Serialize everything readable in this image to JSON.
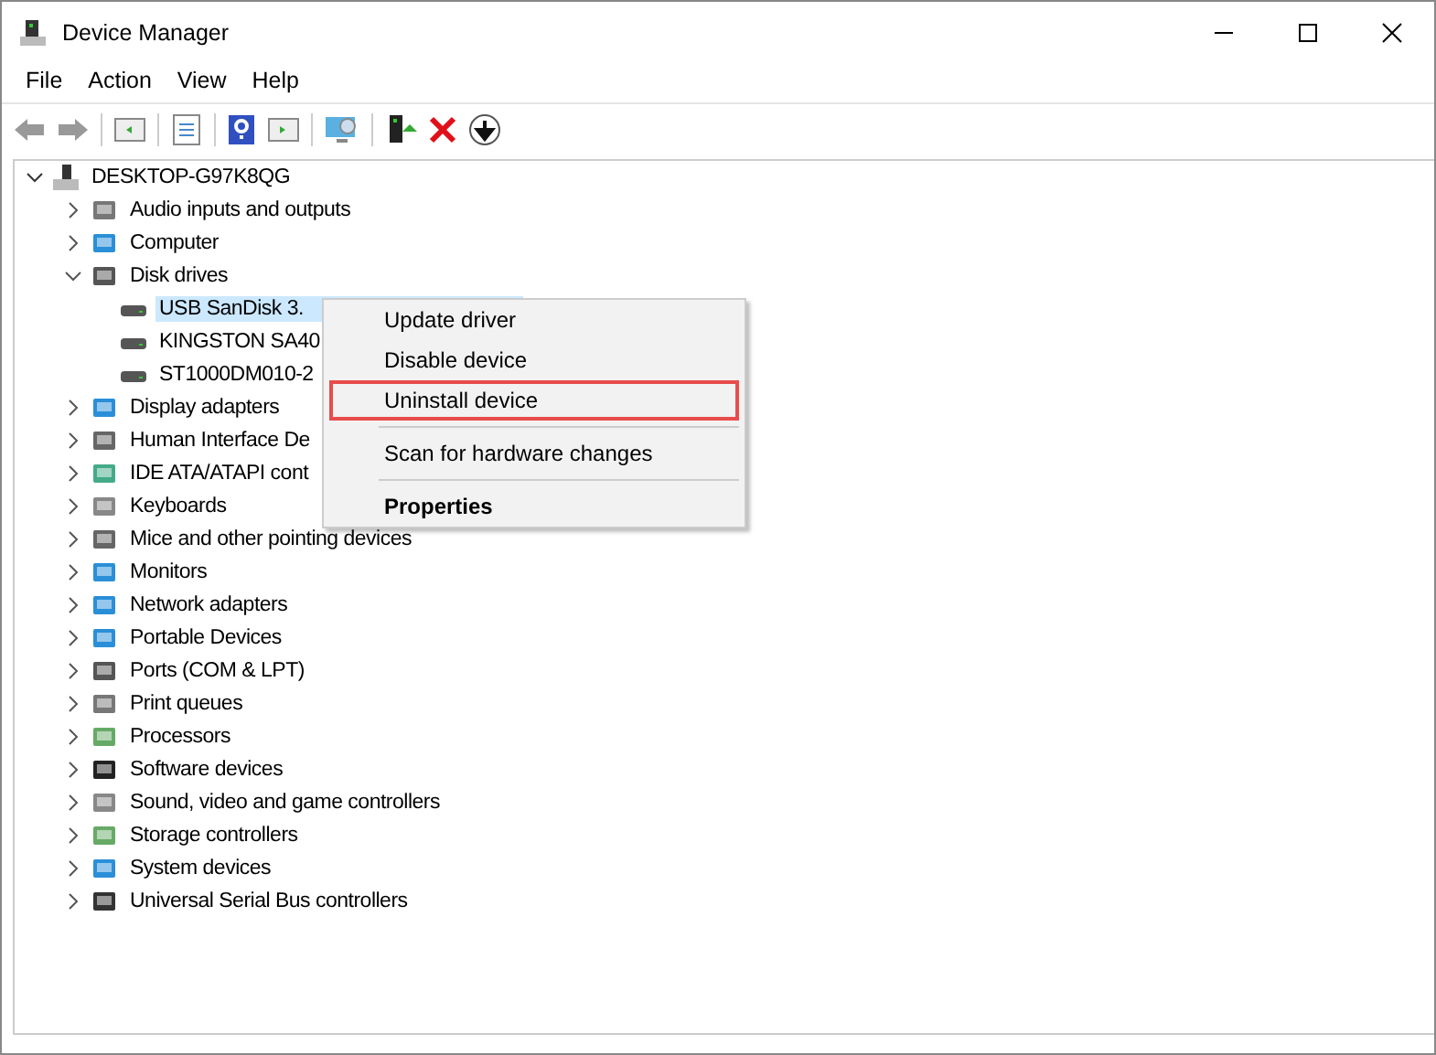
{
  "window": {
    "title": "Device Manager"
  },
  "menu_bar": [
    "File",
    "Action",
    "View",
    "Help"
  ],
  "tree": {
    "label": "DESKTOP-G97K8QG",
    "expanded": true,
    "children": [
      {
        "label": "Audio inputs and outputs",
        "expanded": false
      },
      {
        "label": "Computer",
        "expanded": false
      },
      {
        "label": "Disk drives",
        "expanded": true,
        "children": [
          {
            "label": "USB  SanDisk 3.",
            "selected": true
          },
          {
            "label": "KINGSTON SA40",
            "selected": false
          },
          {
            "label": "ST1000DM010-2",
            "selected": false
          }
        ]
      },
      {
        "label": "Display adapters",
        "expanded": false
      },
      {
        "label": "Human Interface De",
        "expanded": false
      },
      {
        "label": "IDE ATA/ATAPI cont",
        "expanded": false
      },
      {
        "label": "Keyboards",
        "expanded": false
      },
      {
        "label": "Mice and other pointing devices",
        "expanded": false
      },
      {
        "label": "Monitors",
        "expanded": false
      },
      {
        "label": "Network adapters",
        "expanded": false
      },
      {
        "label": "Portable Devices",
        "expanded": false
      },
      {
        "label": "Ports (COM & LPT)",
        "expanded": false
      },
      {
        "label": "Print queues",
        "expanded": false
      },
      {
        "label": "Processors",
        "expanded": false
      },
      {
        "label": "Software devices",
        "expanded": false
      },
      {
        "label": "Sound, video and game controllers",
        "expanded": false
      },
      {
        "label": "Storage controllers",
        "expanded": false
      },
      {
        "label": "System devices",
        "expanded": false
      },
      {
        "label": "Universal Serial Bus controllers",
        "expanded": false
      }
    ]
  },
  "context_menu": {
    "items": [
      {
        "kind": "item",
        "label": "Update driver",
        "highlighted": false
      },
      {
        "kind": "item",
        "label": "Disable device",
        "highlighted": false
      },
      {
        "kind": "item",
        "label": "Uninstall device",
        "highlighted": true
      },
      {
        "kind": "separator"
      },
      {
        "kind": "item",
        "label": "Scan for hardware changes",
        "highlighted": false
      },
      {
        "kind": "separator"
      },
      {
        "kind": "default",
        "label": "Properties",
        "highlighted": false
      }
    ]
  }
}
